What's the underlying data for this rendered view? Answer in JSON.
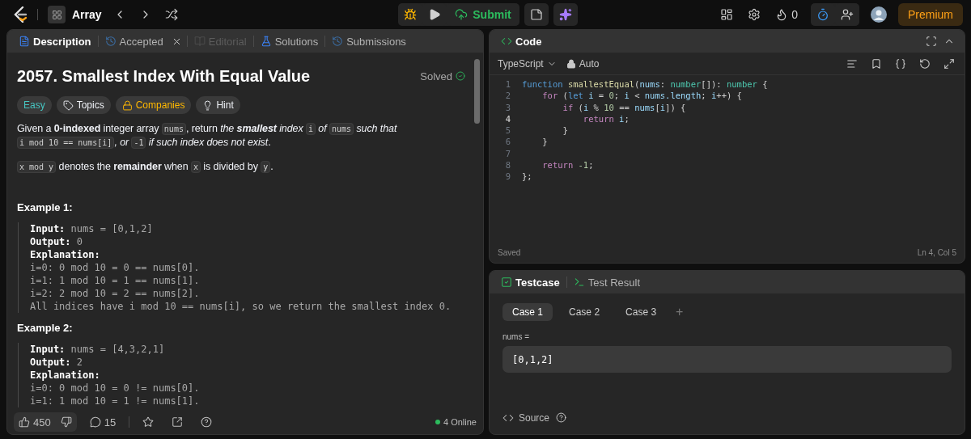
{
  "topbar": {
    "problem_list": "Array",
    "submit": "Submit",
    "streak": "0",
    "premium": "Premium"
  },
  "description_panel": {
    "tabs": [
      {
        "label": "Description",
        "selected": true,
        "disabled": false,
        "closable": false
      },
      {
        "label": "Accepted",
        "selected": false,
        "disabled": false,
        "closable": true
      },
      {
        "label": "Editorial",
        "selected": false,
        "disabled": true,
        "closable": false
      },
      {
        "label": "Solutions",
        "selected": false,
        "disabled": false,
        "closable": false
      },
      {
        "label": "Submissions",
        "selected": false,
        "disabled": false,
        "closable": false
      }
    ],
    "title": "2057. Smallest Index With Equal Value",
    "status": "Solved",
    "tags": [
      {
        "label": "Easy",
        "kind": "difficulty"
      },
      {
        "label": "Topics",
        "kind": "topics"
      },
      {
        "label": "Companies",
        "kind": "companies"
      },
      {
        "label": "Hint",
        "kind": "hint"
      }
    ],
    "paragraphs": [
      [
        {
          "kind": "text",
          "text": "Given a **0-indexed** integer array "
        },
        {
          "kind": "code",
          "text": "nums"
        },
        {
          "kind": "text",
          "text": ", return "
        },
        {
          "kind": "italic",
          "text": "the **smallest** index "
        },
        {
          "kind": "code",
          "text": "i"
        },
        {
          "kind": "italic",
          "text": " of "
        },
        {
          "kind": "code",
          "text": "nums"
        },
        {
          "kind": "italic",
          "text": " such that "
        },
        {
          "kind": "code",
          "text": "i mod 10 == nums[i]"
        },
        {
          "kind": "italic",
          "text": ", or "
        },
        {
          "kind": "code",
          "text": "-1"
        },
        {
          "kind": "italic",
          "text": " if such index does not exist"
        },
        {
          "kind": "text",
          "text": "."
        }
      ],
      [
        {
          "kind": "code",
          "text": "x mod y"
        },
        {
          "kind": "text",
          "text": " denotes the **remainder** when "
        },
        {
          "kind": "code",
          "text": "x"
        },
        {
          "kind": "text",
          "text": " is divided by "
        },
        {
          "kind": "code",
          "text": "y"
        },
        {
          "kind": "text",
          "text": "."
        }
      ]
    ],
    "examples": [
      {
        "heading": "Example 1:",
        "lines": [
          "**Input:** nums = [0,1,2]",
          "**Output:** 0",
          "**Explanation:**",
          "i=0: 0 mod 10 = 0 == nums[0].",
          "i=1: 1 mod 10 = 1 == nums[1].",
          "i=2: 2 mod 10 = 2 == nums[2].",
          "All indices have i mod 10 == nums[i], so we return the smallest index 0."
        ]
      },
      {
        "heading": "Example 2:",
        "lines": [
          "**Input:** nums = [4,3,2,1]",
          "**Output:** 2",
          "**Explanation:**",
          "i=0: 0 mod 10 = 0 != nums[0].",
          "i=1: 1 mod 10 = 1 != nums[1]."
        ]
      }
    ],
    "footer": {
      "likes": "450",
      "comments": "15",
      "online": "4 Online"
    }
  },
  "code_panel": {
    "title": "Code",
    "language": "TypeScript",
    "mode": "Auto",
    "lines": [
      {
        "number": "1",
        "current": false,
        "tokens": [
          {
            "kind": "keyword",
            "text": "function"
          },
          {
            "kind": "function",
            "text": " smallestEqual"
          },
          {
            "kind": "plain",
            "text": "("
          },
          {
            "kind": "variable",
            "text": "nums"
          },
          {
            "kind": "plain",
            "text": ": "
          },
          {
            "kind": "type",
            "text": "number"
          },
          {
            "kind": "plain",
            "text": "[]): "
          },
          {
            "kind": "type",
            "text": "number"
          },
          {
            "kind": "plain",
            "text": " {"
          }
        ]
      },
      {
        "number": "2",
        "current": false,
        "tokens": [
          {
            "kind": "control",
            "text": "    for"
          },
          {
            "kind": "plain",
            "text": " ("
          },
          {
            "kind": "keyword",
            "text": "let"
          },
          {
            "kind": "variable",
            "text": " i"
          },
          {
            "kind": "plain",
            "text": " = "
          },
          {
            "kind": "number",
            "text": "0"
          },
          {
            "kind": "plain",
            "text": "; "
          },
          {
            "kind": "variable",
            "text": "i"
          },
          {
            "kind": "plain",
            "text": " < "
          },
          {
            "kind": "variable",
            "text": "nums.length"
          },
          {
            "kind": "plain",
            "text": "; "
          },
          {
            "kind": "variable",
            "text": "i"
          },
          {
            "kind": "plain",
            "text": "++) {"
          }
        ]
      },
      {
        "number": "3",
        "current": false,
        "tokens": [
          {
            "kind": "control",
            "text": "        if"
          },
          {
            "kind": "plain",
            "text": " ("
          },
          {
            "kind": "variable",
            "text": "i"
          },
          {
            "kind": "plain",
            "text": " % "
          },
          {
            "kind": "number",
            "text": "10"
          },
          {
            "kind": "plain",
            "text": " == "
          },
          {
            "kind": "variable",
            "text": "nums"
          },
          {
            "kind": "plain",
            "text": "["
          },
          {
            "kind": "variable",
            "text": "i"
          },
          {
            "kind": "plain",
            "text": "]) {"
          }
        ]
      },
      {
        "number": "4",
        "current": true,
        "tokens": [
          {
            "kind": "control",
            "text": "            return"
          },
          {
            "kind": "variable",
            "text": " i"
          },
          {
            "kind": "plain",
            "text": ";"
          }
        ]
      },
      {
        "number": "5",
        "current": false,
        "tokens": [
          {
            "kind": "plain",
            "text": "        }"
          }
        ]
      },
      {
        "number": "6",
        "current": false,
        "tokens": [
          {
            "kind": "plain",
            "text": "    }"
          }
        ]
      },
      {
        "number": "7",
        "current": false
      },
      {
        "number": "8",
        "current": false,
        "tokens": [
          {
            "kind": "control",
            "text": "    return"
          },
          {
            "kind": "number",
            "text": " -1"
          },
          {
            "kind": "plain",
            "text": ";"
          }
        ]
      },
      {
        "number": "9",
        "current": false,
        "tokens": [
          {
            "kind": "plain",
            "text": "};"
          }
        ]
      }
    ],
    "save_status": "Saved",
    "cursor": "Ln 4, Col 5"
  },
  "testcase_panel": {
    "tabs": [
      {
        "label": "Testcase",
        "selected": true
      },
      {
        "label": "Test Result",
        "selected": false
      }
    ],
    "cases": [
      {
        "label": "Case 1",
        "selected": true
      },
      {
        "label": "Case 2",
        "selected": false
      },
      {
        "label": "Case 3",
        "selected": false
      }
    ],
    "add_case": "+",
    "param_label": "nums =",
    "param_value": "[0,1,2]",
    "source": "Source"
  }
}
